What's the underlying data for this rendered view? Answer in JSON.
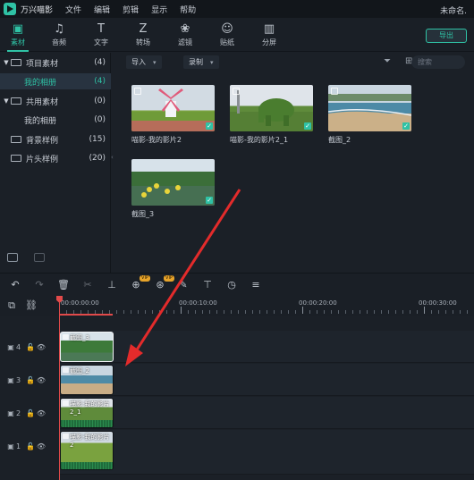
{
  "app": {
    "name": "万兴喵影",
    "project": "未命名.",
    "menu": [
      "文件",
      "编辑",
      "剪辑",
      "显示",
      "帮助"
    ]
  },
  "toolbar": {
    "tabs": [
      {
        "label": "素材",
        "icon": "media-icon",
        "glyph": "▣"
      },
      {
        "label": "音频",
        "icon": "music-note-icon",
        "glyph": "♫"
      },
      {
        "label": "文字",
        "icon": "text-icon",
        "glyph": "T"
      },
      {
        "label": "转场",
        "icon": "transition-icon",
        "glyph": "Z"
      },
      {
        "label": "滤镜",
        "icon": "filter-icon",
        "glyph": "❀"
      },
      {
        "label": "贴纸",
        "icon": "sticker-icon",
        "glyph": "☺"
      },
      {
        "label": "分屏",
        "icon": "split-screen-icon",
        "glyph": "▥"
      }
    ],
    "active_tab": "素材",
    "export_label": "导出"
  },
  "sidebar": {
    "items": [
      {
        "label": "项目素材",
        "count": "(4)",
        "arrow": "▼",
        "folder": true,
        "selected": false
      },
      {
        "label": "我的相册",
        "count": "(4)",
        "arrow": "",
        "folder": false,
        "selected": true
      },
      {
        "label": "共用素材",
        "count": "(0)",
        "arrow": "▼",
        "folder": true,
        "selected": false
      },
      {
        "label": "我的相册",
        "count": "(0)",
        "arrow": "",
        "folder": false,
        "selected": false
      },
      {
        "label": "背景样例",
        "count": "(15)",
        "arrow": "",
        "folder": true,
        "selected": false
      },
      {
        "label": "片头样例",
        "count": "(20)",
        "arrow": "",
        "folder": true,
        "selected": false
      }
    ]
  },
  "media": {
    "import_label": "导入",
    "record_label": "录制",
    "search_placeholder": "搜索",
    "items": [
      {
        "label": "喵影-我的影片2"
      },
      {
        "label": "喵影-我的影片2_1"
      },
      {
        "label": "截图_2"
      },
      {
        "label": "截图_3"
      }
    ]
  },
  "timeline": {
    "timecodes": [
      "00:00:00:00",
      "00:00:10:00",
      "00:00:20:00",
      "00:00:30:00"
    ],
    "tracks": [
      {
        "num": "4",
        "clip_title": "截图_3"
      },
      {
        "num": "3",
        "clip_title": "截图_2"
      },
      {
        "num": "2",
        "clip_title": "喵影-我的影片2_1"
      },
      {
        "num": "1",
        "clip_title": "喵影-我的影片2"
      }
    ],
    "vip_label": "VIP"
  },
  "colors": {
    "accent": "#2fc2a5",
    "playhead": "#e24a4a",
    "annotation_arrow": "#e32b2b"
  }
}
